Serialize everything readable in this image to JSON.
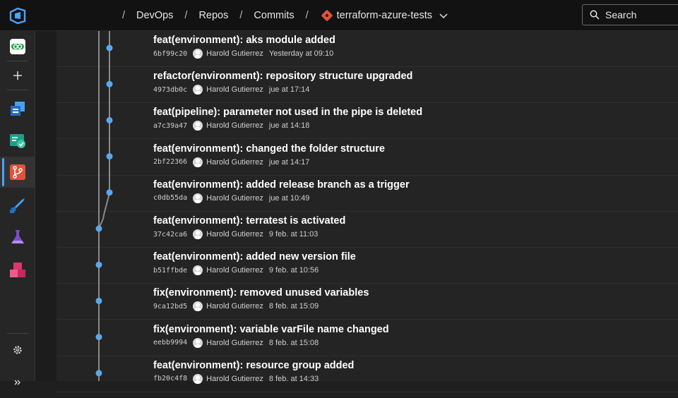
{
  "header": {
    "breadcrumbs": [
      "DevOps",
      "Repos",
      "Commits"
    ],
    "repo_name": "terraform-azure-tests",
    "search_label": "Search"
  },
  "sidebar": {
    "items": [
      "azure-devops-logo",
      "org-icon",
      "add-icon",
      "boards-icon",
      "test-plans-icon",
      "repos-icon",
      "pipelines-icon",
      "test-flask-icon",
      "artifacts-icon",
      "settings-icon",
      "collapse-icon"
    ]
  },
  "commits": [
    {
      "message": "feat(environment): aks module added",
      "hash": "6bf99c20",
      "author": "Harold Gutierrez",
      "date": "Yesterday at 09:10"
    },
    {
      "message": "refactor(environment): repository structure upgraded",
      "hash": "4973db0c",
      "author": "Harold Gutierrez",
      "date": "jue at 17:14"
    },
    {
      "message": "feat(pipeline): parameter not used in the pipe is deleted",
      "hash": "a7c39a47",
      "author": "Harold Gutierrez",
      "date": "jue at 14:18"
    },
    {
      "message": "feat(environment):  changed the folder structure",
      "hash": "2bf22366",
      "author": "Harold Gutierrez",
      "date": "jue at 14:17"
    },
    {
      "message": "feat(environment):  added release branch as a trigger",
      "hash": "c0db55da",
      "author": "Harold Gutierrez",
      "date": "jue at 10:49"
    },
    {
      "message": "feat(environment):  terratest is activated",
      "hash": "37c42ca6",
      "author": "Harold Gutierrez",
      "date": "9 feb. at 11:03"
    },
    {
      "message": "feat(environment):  added new version file",
      "hash": "b51ffbde",
      "author": "Harold Gutierrez",
      "date": "9 feb. at 10:56"
    },
    {
      "message": "fix(environment):  removed unused variables",
      "hash": "9ca12bd5",
      "author": "Harold Gutierrez",
      "date": "8 feb. at 15:09"
    },
    {
      "message": "fix(environment):  variable varFile name changed",
      "hash": "eebb9994",
      "author": "Harold Gutierrez",
      "date": "8 feb. at 15:08"
    },
    {
      "message": "feat(environment):  resource group added",
      "hash": "fb20c4f8",
      "author": "Harold Gutierrez",
      "date": "8 feb. at 14:33"
    }
  ],
  "colors": {
    "graph_node": "#5aa7f0",
    "graph_line": "#8a8a8a",
    "accent": "#4ba3ff"
  }
}
